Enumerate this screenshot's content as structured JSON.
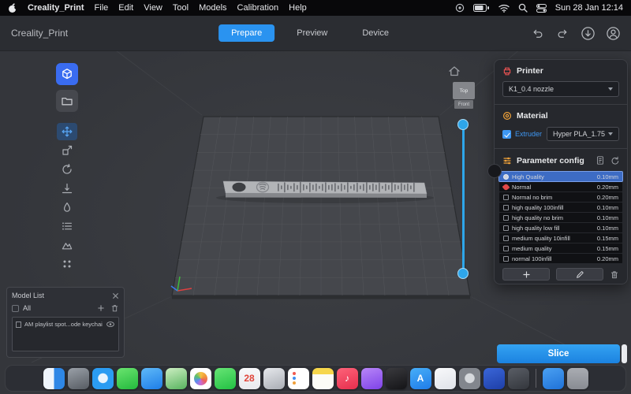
{
  "colors": {
    "accent": "#2f9df5",
    "tab-active": "#2a93f0",
    "selected-row": "#3d6cc4",
    "slice-start": "#34a3f2",
    "slice-end": "#1b82e0",
    "slider": "#2ea6ea",
    "printer-icon": "#e05050",
    "material-icon": "#f0a23a",
    "extruder-blue": "#3e97f2"
  },
  "menubar": {
    "items": [
      {
        "label": "Creality_Print",
        "bold": true
      },
      {
        "label": "File"
      },
      {
        "label": "Edit"
      },
      {
        "label": "View"
      },
      {
        "label": "Tool"
      },
      {
        "label": "Models"
      },
      {
        "label": "Calibration"
      },
      {
        "label": "Help"
      }
    ],
    "clock": "Sun 28 Jan 12:14"
  },
  "window": {
    "title": "Creality_Print",
    "tabs": [
      {
        "label": "Prepare",
        "active": true
      },
      {
        "label": "Preview",
        "active": false
      },
      {
        "label": "Device",
        "active": false
      }
    ]
  },
  "viewport": {
    "view_cube": {
      "top": "Top",
      "front": "Front"
    }
  },
  "right_panel": {
    "printer": {
      "title": "Printer",
      "value": "K1_0.4 nozzle"
    },
    "material": {
      "title": "Material",
      "extruder_label": "Extruder",
      "value": "Hyper PLA_1.75"
    },
    "parameter": {
      "title": "Parameter config",
      "profiles": [
        {
          "name": "High Quality",
          "value": "0.10mm",
          "selected": true
        },
        {
          "name": "Normal",
          "value": "0.20mm",
          "pinned": true
        },
        {
          "name": "Normal no brim",
          "value": "0.20mm"
        },
        {
          "name": "high quality 100infill",
          "value": "0.10mm"
        },
        {
          "name": "high quality no brim",
          "value": "0.10mm"
        },
        {
          "name": "high quality low fill",
          "value": "0.10mm"
        },
        {
          "name": "medium quality 10infill",
          "value": "0.15mm"
        },
        {
          "name": "medium quality",
          "value": "0.15mm"
        },
        {
          "name": "normal 100infill",
          "value": "0.20mm"
        }
      ]
    }
  },
  "model_list": {
    "title": "Model List",
    "all_label": "All",
    "items": [
      {
        "name": "AM playlist spot...ode keychain.stl"
      }
    ]
  },
  "slice_label": "Slice",
  "dock": {
    "items": [
      {
        "name": "finder",
        "kind": "split",
        "c1": "#eef4fb",
        "c2": "#2e87e6"
      },
      {
        "name": "launchpad",
        "c1": "#9aa0a8",
        "c2": "#565b62"
      },
      {
        "name": "safari",
        "kind": "radial",
        "c1": "#e9f4fd",
        "c2": "#2b9cf2"
      },
      {
        "name": "messages",
        "c1": "#6ae46f",
        "c2": "#23b93d"
      },
      {
        "name": "mail",
        "c1": "#5fb9f8",
        "c2": "#1d7de8"
      },
      {
        "name": "maps",
        "c1": "#cdeec2",
        "c2": "#57b35e"
      },
      {
        "name": "photos",
        "kind": "photos",
        "c1": "#ffffff",
        "c2": "#ffffff"
      },
      {
        "name": "facetime",
        "c1": "#67e575",
        "c2": "#22c043"
      },
      {
        "name": "calendar",
        "kind": "calendar",
        "c1": "#f7f8fa",
        "c2": "#e9eaee",
        "glyph": "28",
        "glyph_color": "#e0453a"
      },
      {
        "name": "contacts",
        "c1": "#e6e8ec",
        "c2": "#a9adb4"
      },
      {
        "name": "reminders",
        "kind": "reminders",
        "c1": "#ffffff",
        "c2": "#f0f1f4"
      },
      {
        "name": "notes",
        "kind": "notes",
        "c1": "#f6d64b",
        "c2": "#fcfcf6"
      },
      {
        "name": "music",
        "c1": "#fd6379",
        "c2": "#e62e4d",
        "glyph": "♪",
        "glyph_color": "#ffffff"
      },
      {
        "name": "podcasts",
        "c1": "#b886f8",
        "c2": "#7e42e8"
      },
      {
        "name": "tv",
        "c1": "#3a3a3e",
        "c2": "#141417"
      },
      {
        "name": "app-store",
        "c1": "#47aef8",
        "c2": "#1f7ce8",
        "glyph": "A",
        "glyph_color": "#ffffff"
      },
      {
        "name": "freeform",
        "c1": "#f8f9fb",
        "c2": "#dfe2e8"
      },
      {
        "name": "system-settings",
        "kind": "radial",
        "c1": "#d6d9dd",
        "c2": "#82868d"
      },
      {
        "name": "creality-print",
        "c1": "#3a66d8",
        "c2": "#1e3fa8"
      },
      {
        "name": "utility-app",
        "c1": "#5a5e66",
        "c2": "#33363c"
      },
      {
        "name": "separator",
        "kind": "separator"
      },
      {
        "name": "downloads-folder",
        "c1": "#4aa0f2",
        "c2": "#1f72d8"
      },
      {
        "name": "trash",
        "kind": "trash",
        "c1": "#c9ccd2",
        "c2": "#9fa3aa"
      }
    ]
  }
}
